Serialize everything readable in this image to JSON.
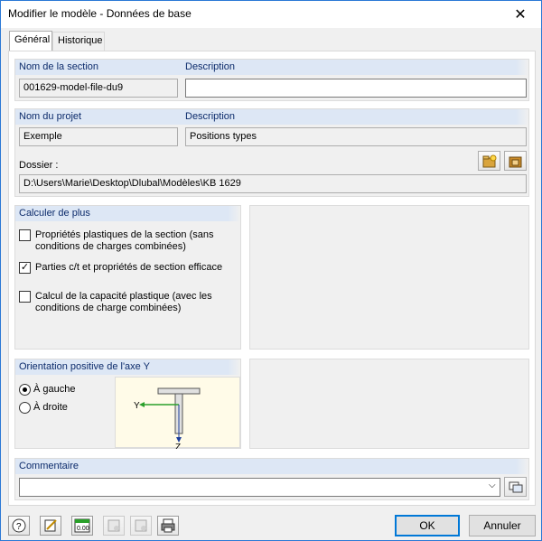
{
  "window": {
    "title": "Modifier le modèle - Données de base",
    "close_glyph": "✕"
  },
  "tabs": [
    {
      "label": "Général",
      "active": true
    },
    {
      "label": "Historique",
      "active": false
    }
  ],
  "section": {
    "name_header": "Nom de la section",
    "name_value": "001629-model-file-du9",
    "desc_header": "Description",
    "desc_value": ""
  },
  "project": {
    "name_header": "Nom du projet",
    "name_value": "Exemple",
    "desc_header": "Description",
    "desc_value": "Positions types",
    "folder_label": "Dossier :",
    "folder_value": "D:\\Users\\Marie\\Desktop\\Dlubal\\Modèles\\KB 1629"
  },
  "calc": {
    "header": "Calculer de plus",
    "options": [
      {
        "label": "Propriétés plastiques de la section (sans conditions de charges combinées)",
        "checked": false
      },
      {
        "label": "Parties c/t et propriétés de section efficace",
        "checked": true
      },
      {
        "label": "Calcul de la capacité plastique (avec les conditions de charge combinées)",
        "checked": false
      }
    ]
  },
  "orientation": {
    "header": "Orientation positive de l'axe Y",
    "options": [
      {
        "label": "À gauche",
        "selected": true
      },
      {
        "label": "À droite",
        "selected": false
      }
    ],
    "axis_y": "Y",
    "axis_z": "Z"
  },
  "comment": {
    "header": "Commentaire",
    "value": ""
  },
  "footer": {
    "ok_label": "OK",
    "cancel_label": "Annuler"
  },
  "colors": {
    "header_bg": "#dde7f5",
    "header_text": "#0c2b6b",
    "accent": "#0078d7"
  }
}
